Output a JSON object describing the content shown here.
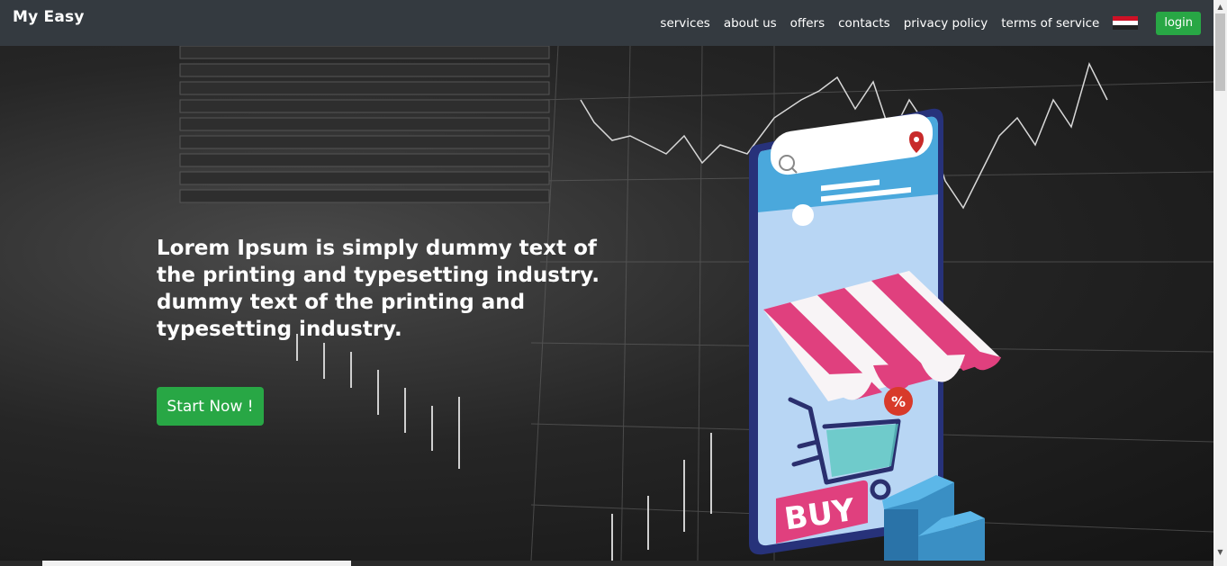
{
  "navbar": {
    "brand": "My Easy",
    "links": [
      {
        "label": "services"
      },
      {
        "label": "about us"
      },
      {
        "label": "offers"
      },
      {
        "label": "contacts"
      },
      {
        "label": "privacy policy"
      },
      {
        "label": "terms of service"
      }
    ],
    "flag_icon": "egypt-flag-icon",
    "login_label": "login"
  },
  "hero": {
    "title": "Lorem Ipsum is simply dummy text of the printing and typesetting industry. dummy text of the printing and typesetting industry.",
    "cta_label": "Start Now !",
    "illustration": {
      "buy_label": "BUY",
      "discount_label": "%"
    }
  },
  "colors": {
    "navbar_bg": "#343a40",
    "accent_green": "#28a745",
    "awning_pink": "#e0407e",
    "phone_blue": "#4aa8dc"
  }
}
